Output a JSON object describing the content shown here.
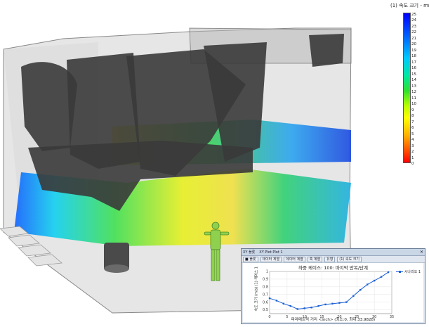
{
  "legend": {
    "title": "(1) 속도 크기 - mm/s",
    "ticks": [
      "25",
      "24",
      "23",
      "22",
      "21",
      "20",
      "19",
      "18",
      "17",
      "16",
      "15",
      "14",
      "13",
      "12",
      "11",
      "10",
      "9",
      "8",
      "7",
      "6",
      "5",
      "4",
      "3",
      "2",
      "1",
      "0"
    ]
  },
  "plot_window": {
    "tabs": [
      "XY 플롯",
      "XY Plot Plot 1"
    ],
    "toolbar": [
      "■ 플롯",
      "데이터 계열",
      "데이터 계열",
      "축 계열",
      "유형",
      "(1) 속도 크기"
    ],
    "title": "하중 케이스: 100: 마지막 반복/단계",
    "ylabel": "속도 크기 (m/s) (1) 케이스 1",
    "xlabel": "파라메트릭 거리 <inch> (최소:0, 최대:33.9828)",
    "legend_label": "시나리오 1",
    "colors": {
      "line": "#1a5fd6"
    }
  },
  "chart_data": {
    "type": "line",
    "x": [
      0,
      2,
      4,
      6,
      8,
      10,
      12,
      14,
      16,
      18,
      20,
      22,
      24,
      26,
      28,
      30,
      32,
      34
    ],
    "series": [
      {
        "name": "시나리오 1",
        "values": [
          0.65,
          0.62,
          0.58,
          0.55,
          0.51,
          0.52,
          0.53,
          0.55,
          0.57,
          0.58,
          0.59,
          0.6,
          0.68,
          0.76,
          0.83,
          0.88,
          0.93,
          0.99
        ]
      }
    ],
    "xlabel": "파라메트릭 거리 <inch> (최소:0, 최대:33.9828)",
    "ylabel": "속도 크기 (m/s) (1) 케이스 1",
    "xticks": [
      "0",
      "5",
      "10",
      "15",
      "20",
      "25",
      "30",
      "35"
    ],
    "yticks": [
      "0.5",
      "0.6",
      "0.7",
      "0.8",
      "0.9",
      "1"
    ],
    "xlim": [
      0,
      35
    ],
    "ylim": [
      0.45,
      1.0
    ]
  }
}
